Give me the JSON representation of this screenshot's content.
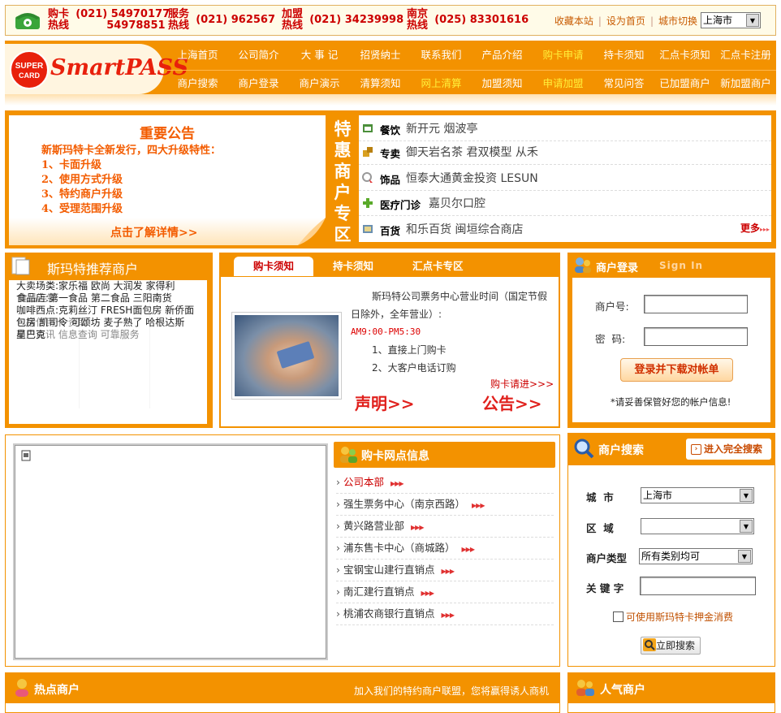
{
  "hotlines": [
    {
      "label1": "购卡",
      "label2": "热线",
      "num1": "(021) 54970177",
      "num2": "54978851"
    },
    {
      "label1": "服务",
      "label2": "热线",
      "num1": "(021) 962567"
    },
    {
      "label1": "加盟",
      "label2": "热线",
      "num1": "(021) 34239998"
    },
    {
      "label1": "南京",
      "label2": "热线",
      "num1": "(025) 83301616"
    }
  ],
  "top_links": {
    "favorite": "收藏本站",
    "homepage": "设为首页",
    "city_switch": "城市切换",
    "city": "上海市"
  },
  "logo": {
    "badge_top": "SUPER",
    "badge_bottom": "CARD",
    "brand": "SmartPASS"
  },
  "nav_row1": [
    "上海首页",
    "公司简介",
    "大 事 记",
    "招贤纳士",
    "联系我们",
    "产品介绍",
    "购卡申请",
    "持卡须知",
    "汇点卡须知",
    "汇点卡注册"
  ],
  "nav_row2": [
    "商户搜索",
    "商户登录",
    "商户演示",
    "清算须知",
    "网上清算",
    "加盟须知",
    "申请加盟",
    "常见问答",
    "已加盟商户",
    "新加盟商户"
  ],
  "announcement": {
    "title": "重要公告",
    "subtitle": "新斯玛特卡全新发行，四大升级特性：",
    "points": [
      "1、卡面升级",
      "2、使用方式升级",
      "3、特约商户升级",
      "4、受理范围升级"
    ],
    "more": "点击了解详情>>"
  },
  "zone_label": [
    "特",
    "惠",
    "商",
    "户",
    "专",
    "区"
  ],
  "special_merchants": [
    {
      "cat": "餐饮",
      "items": "新开元  烟波亭"
    },
    {
      "cat": "专卖",
      "items": "御天岩名茶  君双模型  从禾"
    },
    {
      "cat": "饰品",
      "items": "恒泰大通黄金投资  LESUN"
    },
    {
      "cat": "医疗门诊",
      "items": "嘉贝尔口腔"
    },
    {
      "cat": "百货",
      "items": "和乐百货  闽垣综合商店"
    }
  ],
  "more_label": "更多",
  "recommend": {
    "title": "斯玛特推荐商户",
    "lines": [
      "大卖场类:家乐福 欧尚 大润发 家得利",
      "食品店:第一食品 第二食品 三阳南货",
      "咖啡西点:克莉丝汀 FRESH面包房 新侨面",
      "包房 凯司令 可颂坊 麦子熟了 哈根达斯",
      "星巴克"
    ],
    "overlay_lines": [
      "食品连锁",
      "包括信用卡 资助",
      "商户资讯 信息查询 可靠服务"
    ]
  },
  "info_tabs": [
    "购卡须知",
    "持卡须知",
    "汇点卡专区"
  ],
  "info": {
    "hours_line1": "斯玛特公司票务中心营业时间（国定节假",
    "hours_line2": "日除外，全年营业）:",
    "hours_time": "AM9:00-PM5:30",
    "methods": [
      "1、直接上门购卡",
      "2、大客户电话订购"
    ],
    "more": "购卡请进>>>",
    "statement": "声明>>",
    "notice": "公告>>"
  },
  "login": {
    "title": "商户登录",
    "title_en": "Sign In",
    "merchant_no_label": "商户号:",
    "password_label": "密  码:",
    "button": "登录并下载对帐单",
    "note": "*请妥善保管好您的帐户信息!"
  },
  "network": {
    "title": "购卡网点信息",
    "items": [
      "公司本部",
      "强生票务中心（南京西路）",
      "黄兴路营业部",
      "浦东售卡中心（商城路）",
      "宝钢宝山建行直销点",
      "南汇建行直销点",
      "桃浦农商银行直销点"
    ]
  },
  "search": {
    "title": "商户搜索",
    "full_search": "进入完全搜索",
    "city_label": "城  市",
    "city_value": "上海市",
    "area_label": "区  域",
    "area_value": "",
    "type_label": "商户类型",
    "type_value": "所有类别均可",
    "keyword_label": "关 键 字",
    "keyword_value": "",
    "deposit_label": "可使用斯玛特卡押金消费",
    "submit": "立即搜索"
  },
  "hot": {
    "title": "热点商户",
    "slogan": "加入我们的特约商户联盟，您将赢得诱人商机"
  },
  "popular": {
    "title": "人气商户"
  },
  "colors": {
    "orange": "#f39200",
    "red": "#cc0000",
    "nav_highlight": "#ffef3a"
  }
}
